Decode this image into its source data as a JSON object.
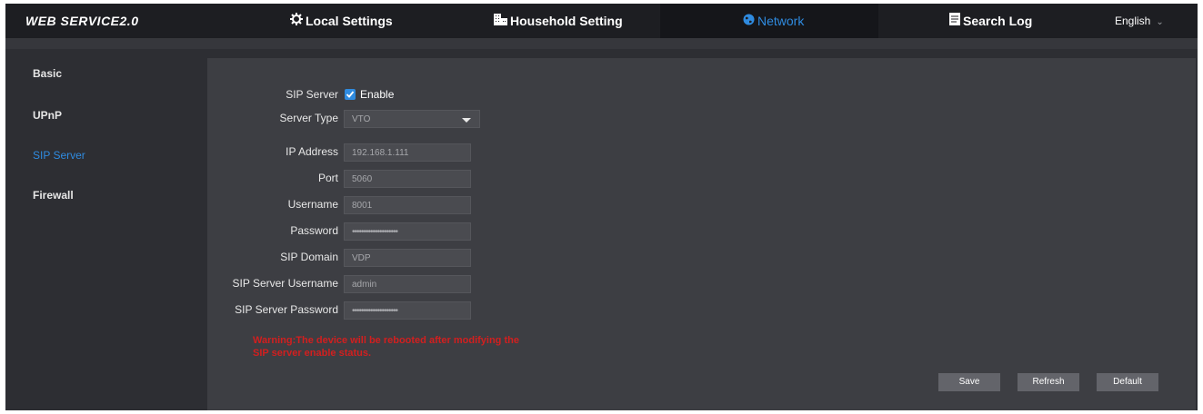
{
  "header": {
    "brand": "WEB SERVICE2.0",
    "nav": [
      {
        "label": "Local Settings",
        "icon": "gear-icon"
      },
      {
        "label": "Household Setting",
        "icon": "building-icon"
      },
      {
        "label": "Network",
        "icon": "globe-icon",
        "active": true
      },
      {
        "label": "Search Log",
        "icon": "document-icon"
      }
    ],
    "language": "English"
  },
  "sidebar": {
    "items": [
      {
        "label": "Basic"
      },
      {
        "label": "UPnP"
      },
      {
        "label": "SIP Server",
        "active": true
      },
      {
        "label": "Firewall"
      }
    ]
  },
  "form": {
    "sip_server": {
      "label": "SIP Server",
      "checkbox_label": "Enable",
      "checked": true
    },
    "server_type": {
      "label": "Server Type",
      "value": "VTO"
    },
    "ip_address": {
      "label": "IP Address",
      "value": "192.168.1.111"
    },
    "port": {
      "label": "Port",
      "value": "5060"
    },
    "username": {
      "label": "Username",
      "value": "8001"
    },
    "password": {
      "label": "Password",
      "value": "••••••••••••••••••••"
    },
    "sip_domain": {
      "label": "SIP Domain",
      "value": "VDP"
    },
    "sip_server_username": {
      "label": "SIP Server Username",
      "value": "admin"
    },
    "sip_server_password": {
      "label": "SIP Server Password",
      "value": "••••••••••••••••••••"
    },
    "warning_line1": "Warning:The device will be rebooted after modifying the",
    "warning_line2": "SIP server enable status."
  },
  "buttons": {
    "save": "Save",
    "refresh": "Refresh",
    "default": "Default"
  },
  "colors": {
    "accent": "#2f8be0",
    "warning": "#d21f1f",
    "topbar": "#1d1e22",
    "panel": "#3d3e43"
  }
}
